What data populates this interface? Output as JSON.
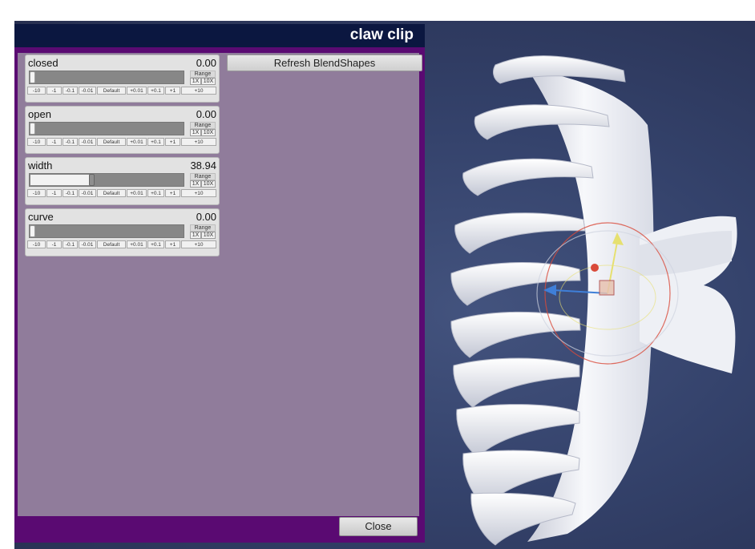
{
  "window": {
    "title": "claw clip",
    "close_label": "Close",
    "refresh_label": "Refresh BlendShapes"
  },
  "blendshapes": [
    {
      "name": "closed",
      "value": "0.00",
      "fraction": 0.0
    },
    {
      "name": "open",
      "value": "0.00",
      "fraction": 0.0
    },
    {
      "name": "width",
      "value": "38.94",
      "fraction": 0.3894
    },
    {
      "name": "curve",
      "value": "0.00",
      "fraction": 0.0
    }
  ],
  "range": {
    "label": "Range",
    "x1": "1X",
    "x10": "10X"
  },
  "steps": [
    "-10",
    "-1",
    "-0.1",
    "-0.01",
    "Default",
    "+0.01",
    "+0.1",
    "+1",
    "+10"
  ],
  "colors": {
    "panel_frame": "#5a0a72",
    "panel_content": "#907c9b",
    "title_bar": "#0b1740",
    "viewport_bg": "#34426b",
    "model": "#f4f5f8"
  },
  "viewport": {
    "model_icon": "claw-clip-model",
    "gizmo_icon": "transform-gizmo-icon"
  }
}
